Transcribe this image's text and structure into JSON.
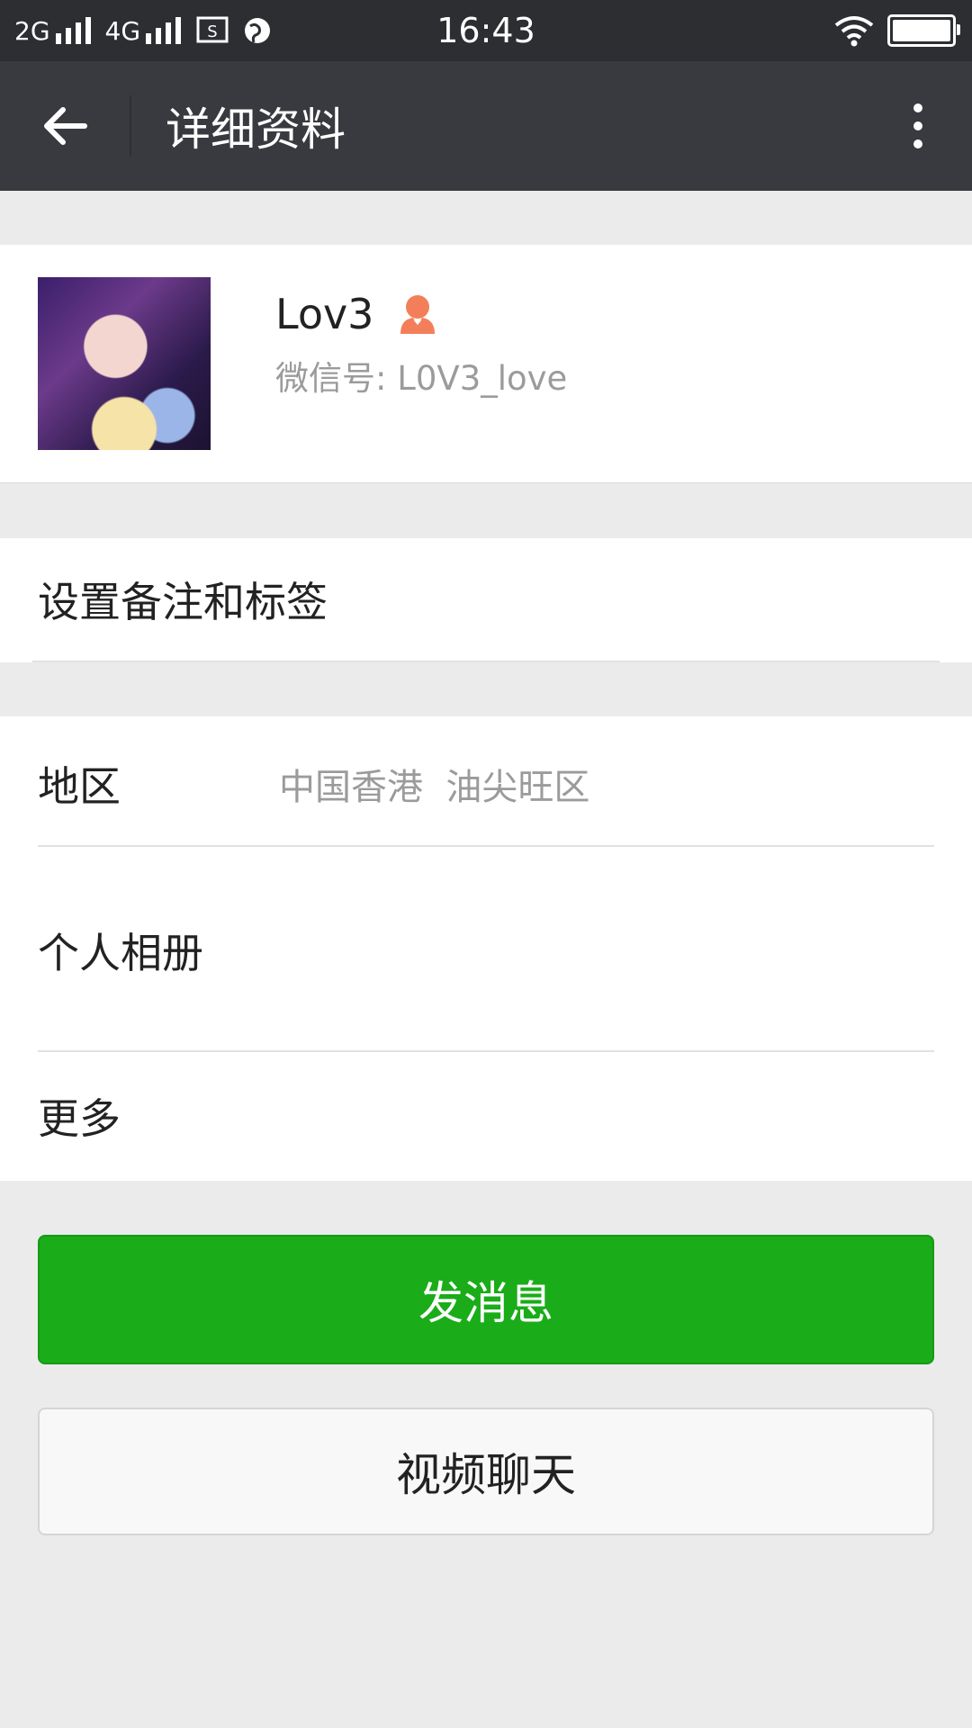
{
  "status_bar": {
    "network_1": "2G",
    "network_2": "4G",
    "time": "16:43",
    "battery_level": 1.0
  },
  "header": {
    "title": "详细资料"
  },
  "profile": {
    "name": "Lov3",
    "wechat_id_label": "微信号: ",
    "wechat_id": "L0V3_love",
    "gender": "female",
    "gender_color": "#f37e5a"
  },
  "remark": {
    "label": "设置备注和标签"
  },
  "info": {
    "region_label": "地区",
    "region_value": "中国香港  油尖旺区",
    "album_label": "个人相册",
    "more_label": "更多"
  },
  "actions": {
    "send_message": "发消息",
    "video_chat": "视频聊天"
  },
  "colors": {
    "primary_green": "#1aad19",
    "header_bg": "#393a3f",
    "status_bg": "#2d2e32"
  }
}
